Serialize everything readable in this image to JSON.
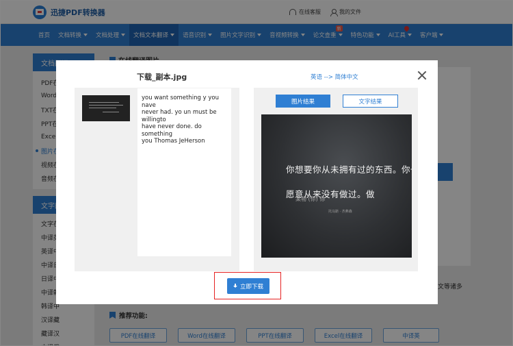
{
  "header": {
    "brand": "迅捷PDF转换器",
    "service_label": "在线客服",
    "files_label": "我的文件"
  },
  "nav": {
    "items": [
      {
        "label": "首页"
      },
      {
        "label": "文档转换"
      },
      {
        "label": "文档处理"
      },
      {
        "label": "文档文本翻译"
      },
      {
        "label": "语音识别"
      },
      {
        "label": "图片文字识别"
      },
      {
        "label": "音视频转换"
      },
      {
        "label": "论文查重"
      },
      {
        "label": "特色功能"
      },
      {
        "label": "AI工具"
      },
      {
        "label": "客户端"
      }
    ],
    "new_badge": "新"
  },
  "sidebar": {
    "doc_heading": "文档翻译",
    "doc_items": [
      "PDF在",
      "Word",
      "TXT在",
      "PPT在",
      "Excel",
      "图片在",
      "视频在",
      "音频在"
    ],
    "text_heading": "文字翻",
    "text_items": [
      "文字在",
      "中译英",
      "英译中",
      "中译日",
      "日译中",
      "中译韩",
      "韩译中",
      "汉译藏",
      "藏译汉",
      "中译俄"
    ]
  },
  "page": {
    "title": "在线翻译图片",
    "trailing_text": "文等诸多",
    "recommend_title": "推荐功能:",
    "recommend_buttons": [
      "PDF在线翻译",
      "Word在线翻译",
      "PPT在线翻译",
      "Excel在线翻译",
      "中译英"
    ]
  },
  "modal": {
    "filename": "下载_副本.jpg",
    "language": "英语 --> 简体中文",
    "ocr_text": "you want something y you nave\nnever had. yo un must be willingto\nhave never done. do  something\nyou  Thomas JeHerson",
    "tab_image": "图片结果",
    "tab_text": "文字结果",
    "result_line1": "你想要你从未拥有过的东西。你一定",
    "result_line2": "愿意从来没有做过。做",
    "result_ghost": "某物   (你)  你",
    "result_sign": "托马斯 · 杰弗森",
    "download_label": "立即下载"
  }
}
